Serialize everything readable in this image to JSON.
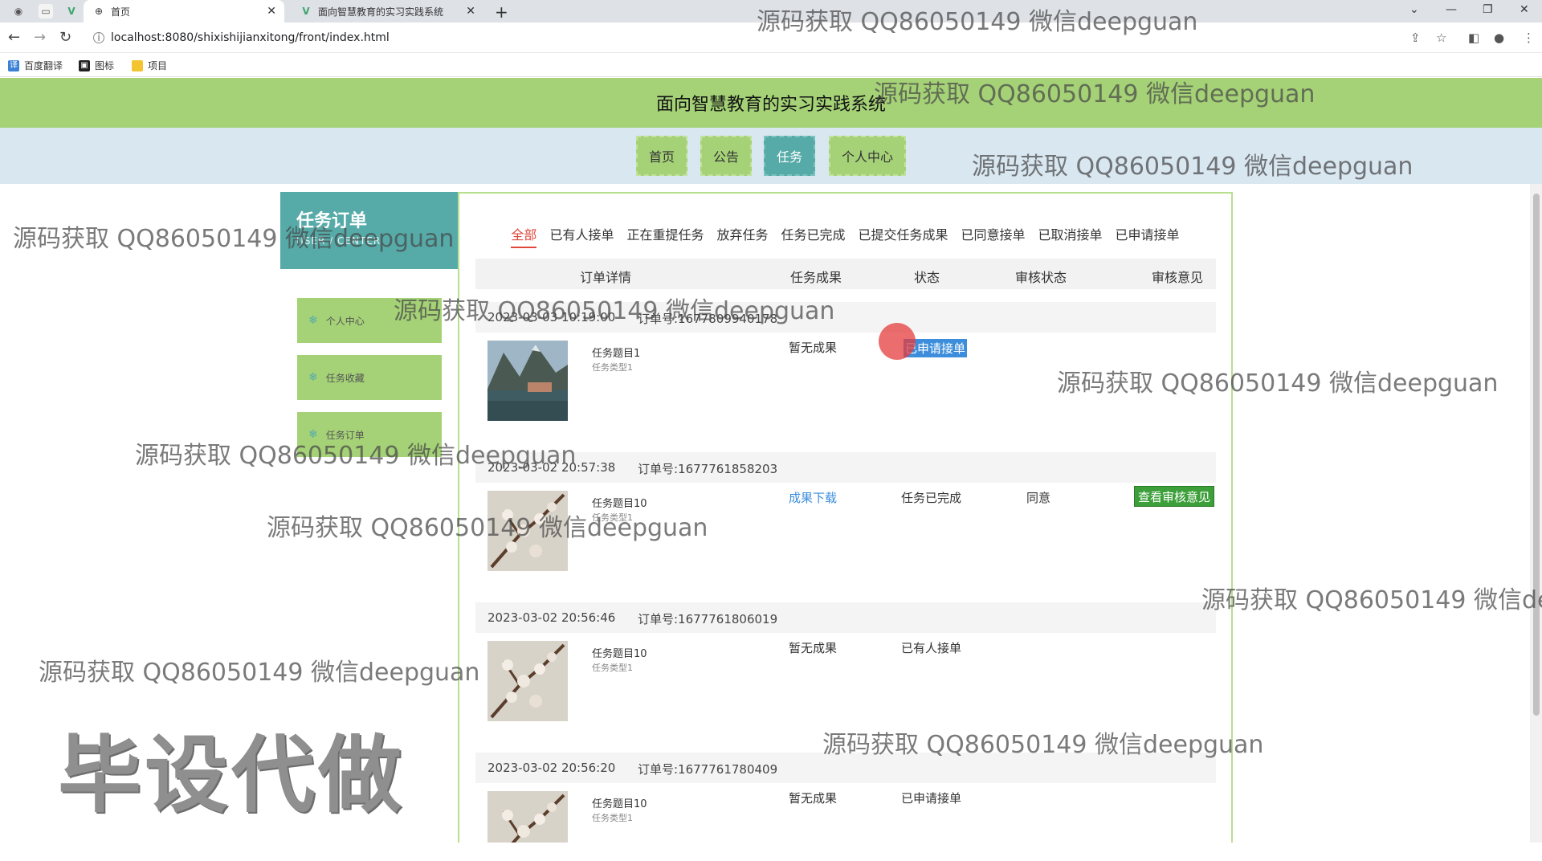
{
  "browser": {
    "tabs": [
      {
        "title": "首页",
        "active": true
      },
      {
        "title": "面向智慧教育的实习实践系统",
        "active": false
      }
    ],
    "url": "localhost:8080/shixishijianxitong/front/index.html",
    "bookmarks": [
      "百度翻译",
      "图标",
      "项目"
    ]
  },
  "site": {
    "title": "面向智慧教育的实习实践系统",
    "nav": [
      "首页",
      "公告",
      "任务",
      "个人中心"
    ],
    "nav_active": "任务"
  },
  "sidebar": {
    "title": "任务订单",
    "subtitle": "USER / CENTER",
    "items": [
      "个人中心",
      "任务收藏",
      "任务订单"
    ]
  },
  "filters": {
    "items": [
      "全部",
      "已有人接单",
      "正在重提任务",
      "放弃任务",
      "任务已完成",
      "已提交任务成果",
      "已同意接单",
      "已取消接单",
      "已申请接单"
    ],
    "active": "全部"
  },
  "table": {
    "headers": [
      "订单详情",
      "任务成果",
      "状态",
      "审核状态",
      "审核意见"
    ]
  },
  "orders": [
    {
      "date": "2023-03-03 10:19:00",
      "order_no": "订单号:1677809940178",
      "name": "任务题目1",
      "type": "任务类型1",
      "result": "暂无成果",
      "status": "已申请接单",
      "review_status": "",
      "review_opinion": "",
      "image": "mountain-lake"
    },
    {
      "date": "2023-03-02 20:57:38",
      "order_no": "订单号:1677761858203",
      "name": "任务题目10",
      "type": "任务类型1",
      "result": "成果下载",
      "status": "任务已完成",
      "review_status": "同意",
      "review_opinion": "查看审核意见",
      "image": "blossom-branch"
    },
    {
      "date": "2023-03-02 20:56:46",
      "order_no": "订单号:1677761806019",
      "name": "任务题目10",
      "type": "任务类型1",
      "result": "暂无成果",
      "status": "已有人接单",
      "review_status": "",
      "review_opinion": "",
      "image": "blossom-branch"
    },
    {
      "date": "2023-03-02 20:56:20",
      "order_no": "订单号:1677761780409",
      "name": "任务题目10",
      "type": "任务类型1",
      "result": "暂无成果",
      "status": "已申请接单",
      "review_status": "",
      "review_opinion": "",
      "image": "blossom-branch"
    }
  ],
  "watermarks": {
    "text": "源码获取 QQ86050149 微信deepguan",
    "cut_text": "源码获取 QQ86050149 微信de",
    "stamp": "毕设代做"
  },
  "colors": {
    "header_green": "#a5d277",
    "teal": "#56aba8",
    "nav_bg": "#d9e7f1",
    "filter_active": "#e0473b",
    "link_blue": "#3c8ddb",
    "button_green": "#3c9f3a"
  }
}
